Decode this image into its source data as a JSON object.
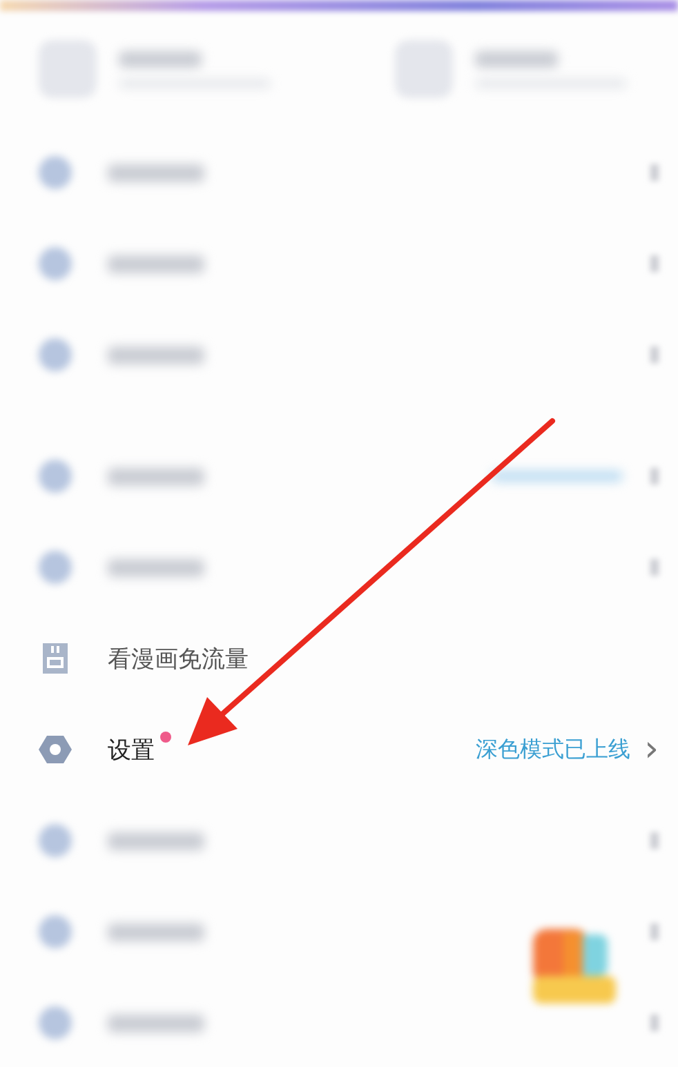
{
  "header_cards": [
    {
      "kind": "blurred"
    },
    {
      "kind": "blurred"
    }
  ],
  "menu_sections": [
    {
      "items": [
        {
          "kind": "blurred"
        },
        {
          "kind": "blurred"
        },
        {
          "kind": "blurred"
        }
      ]
    },
    {
      "items": [
        {
          "kind": "blurrednote"
        },
        {
          "kind": "blurred"
        },
        {
          "kind": "traffic",
          "label": "看漫画免流量"
        },
        {
          "kind": "settings",
          "label": "设置",
          "dot": true,
          "note_text": "深色模式已上线",
          "chevron": "›"
        },
        {
          "kind": "blurred"
        },
        {
          "kind": "blurred"
        },
        {
          "kind": "blurred"
        }
      ]
    }
  ],
  "annotation": {
    "kind": "arrow"
  }
}
